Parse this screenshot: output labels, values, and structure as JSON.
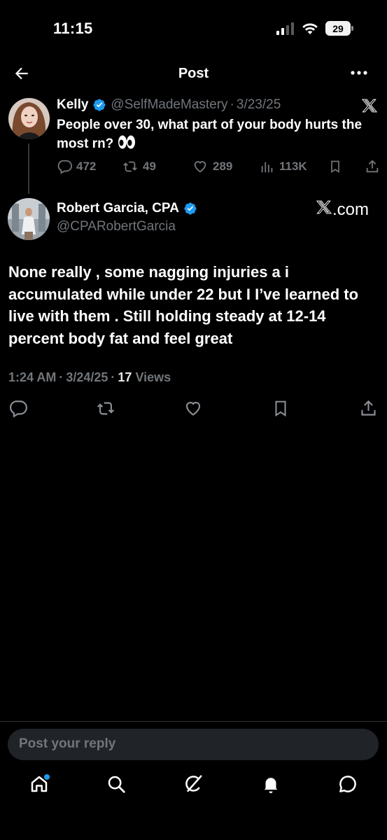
{
  "status_bar": {
    "time": "11:15",
    "battery": "29",
    "icons": [
      "cellular-signal-icon",
      "wifi-icon",
      "battery-icon"
    ]
  },
  "nav": {
    "title": "Post",
    "back_icon": "back-arrow-icon",
    "more_icon": "more-icon"
  },
  "parent_post": {
    "name": "Kelly",
    "handle": "@SelfMadeMastery",
    "separator": "·",
    "date": "3/23/25",
    "text": "People over 30, what part of your body hurts the most rn?",
    "emoji": "eyes-emoji",
    "stats": {
      "replies": "472",
      "reposts": "49",
      "likes": "289",
      "views": "113K"
    }
  },
  "reply_post": {
    "name": "Robert Garcia, CPA",
    "handle": "@CPARobertGarcia",
    "watermark": ".com",
    "text": "None really , some nagging injuries a i accumulated while under 22 but I I’ve learned to live with them . Still holding steady at 12-14 percent body fat and feel great",
    "time": "1:24 AM",
    "date": "3/24/25",
    "views_count": "17",
    "views_label": "Views"
  },
  "composer": {
    "placeholder": "Post your reply"
  },
  "tabbar": {
    "items": [
      "home-icon",
      "search-icon",
      "grok-icon",
      "notifications-icon",
      "messages-icon"
    ]
  },
  "colors": {
    "background": "#000000",
    "verified": "#1d9bf0",
    "muted": "#71767b",
    "text": "#e7e9ea"
  }
}
